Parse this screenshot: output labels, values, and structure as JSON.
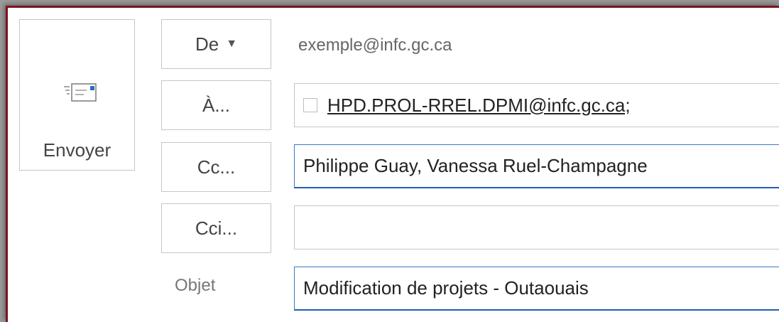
{
  "send": {
    "label": "Envoyer",
    "icon": "send-mail-icon"
  },
  "from": {
    "button_label": "De",
    "button_icon": "caret-down-icon",
    "address": "exemple@infc.gc.ca"
  },
  "to": {
    "button_label": "À...",
    "recipients": "HPD.PROL-RREL.DPMI@infc.gc.ca;"
  },
  "cc": {
    "button_label": "Cc...",
    "value": "Philippe Guay, Vanessa Ruel-Champagne"
  },
  "bcc": {
    "button_label": "Cci...",
    "value": ""
  },
  "subject": {
    "label": "Objet",
    "value": "Modification de projets - Outaouais"
  },
  "colors": {
    "border_accent": "#7a1420",
    "focus_blue": "#3b78c3"
  }
}
